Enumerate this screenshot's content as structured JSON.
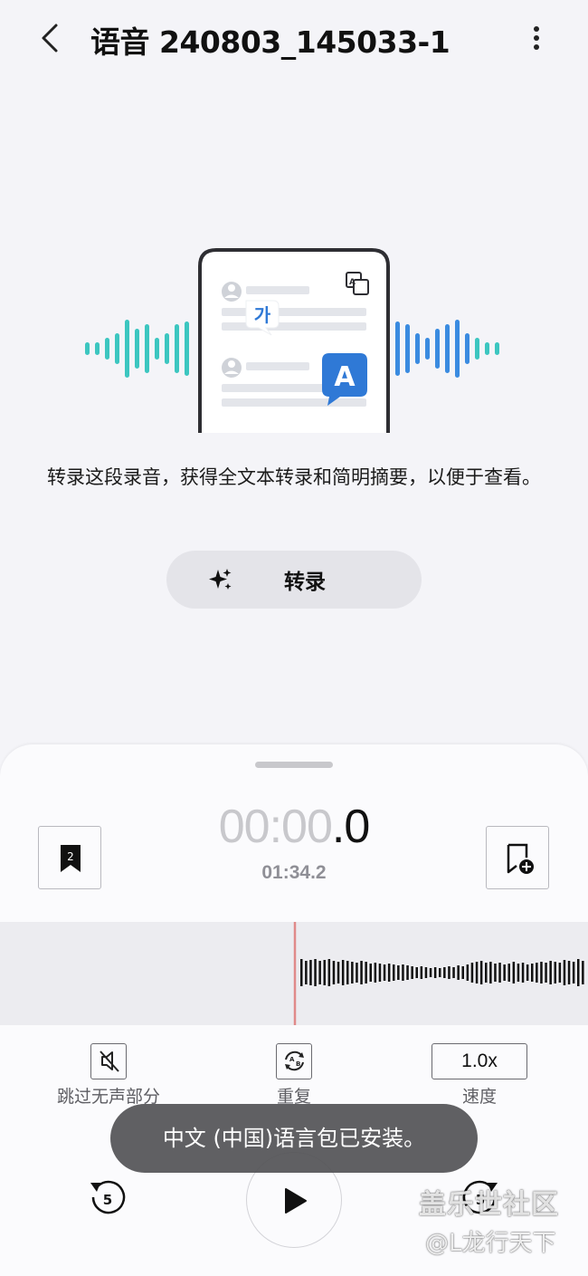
{
  "header": {
    "title": "语音 240803_145033-1",
    "back_icon": "chevron-left-icon",
    "more_icon": "more-vertical-icon"
  },
  "illustration": {
    "korean_glyph": "가",
    "latin_glyph": "A",
    "accent_color": "#2f79d6",
    "wave_color_left": "#3cc6c0",
    "wave_color_right": "#3a8be0"
  },
  "description": "转录这段录音，获得全文本转录和简明摘要，以便于查看。",
  "transcribe_button": {
    "label": "转录",
    "icon": "sparkle-icon"
  },
  "player": {
    "elapsed_dim": "00:00",
    "elapsed_lit": ".0",
    "total": "01:34.2",
    "bookmark_count": "2",
    "playhead_color": "#e08a8a",
    "controls": [
      {
        "label": "跳过无声部分",
        "icon": "mute-speaker-icon"
      },
      {
        "label": "重复",
        "icon": "repeat-ab-icon"
      },
      {
        "label": "速度",
        "value": "1.0x"
      }
    ],
    "rewind_seconds": "5",
    "forward_seconds": "5"
  },
  "toast": "中文 (中国)语言包已安装。",
  "watermark": {
    "line1": "盖乐世社区",
    "line2": "@L龙行天下"
  }
}
